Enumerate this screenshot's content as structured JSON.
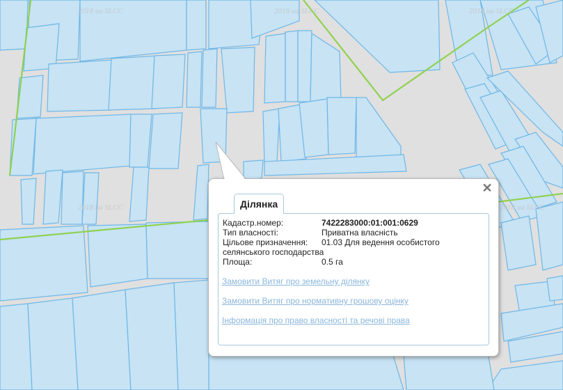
{
  "map": {
    "watermark": "2018 ua SLCC",
    "colors": {
      "parcel_fill": "#c7e3f4",
      "parcel_stroke": "#6fb7e6",
      "boundary": "#8fd14f",
      "background": "#e0e0e0"
    }
  },
  "popup": {
    "tab_label": "Ділянка",
    "close_icon": "close-icon",
    "fields": [
      {
        "label": "Кадастр.номер:",
        "value": "7422283000:01:001:0629"
      },
      {
        "label": "Тип власності:",
        "value": "Приватна власність"
      },
      {
        "label": "Цільове призначення:",
        "value": "01.03 Для ведення особистого"
      },
      {
        "label": "",
        "value": "селянського господарства"
      },
      {
        "label": "Площа:",
        "value": "0.5 га"
      }
    ],
    "links": [
      "Замовити Витяг про земельну ділянку",
      "Замовити Витяг про нормативну грошову оцінку",
      "Інформація про право власності та речові права"
    ]
  }
}
